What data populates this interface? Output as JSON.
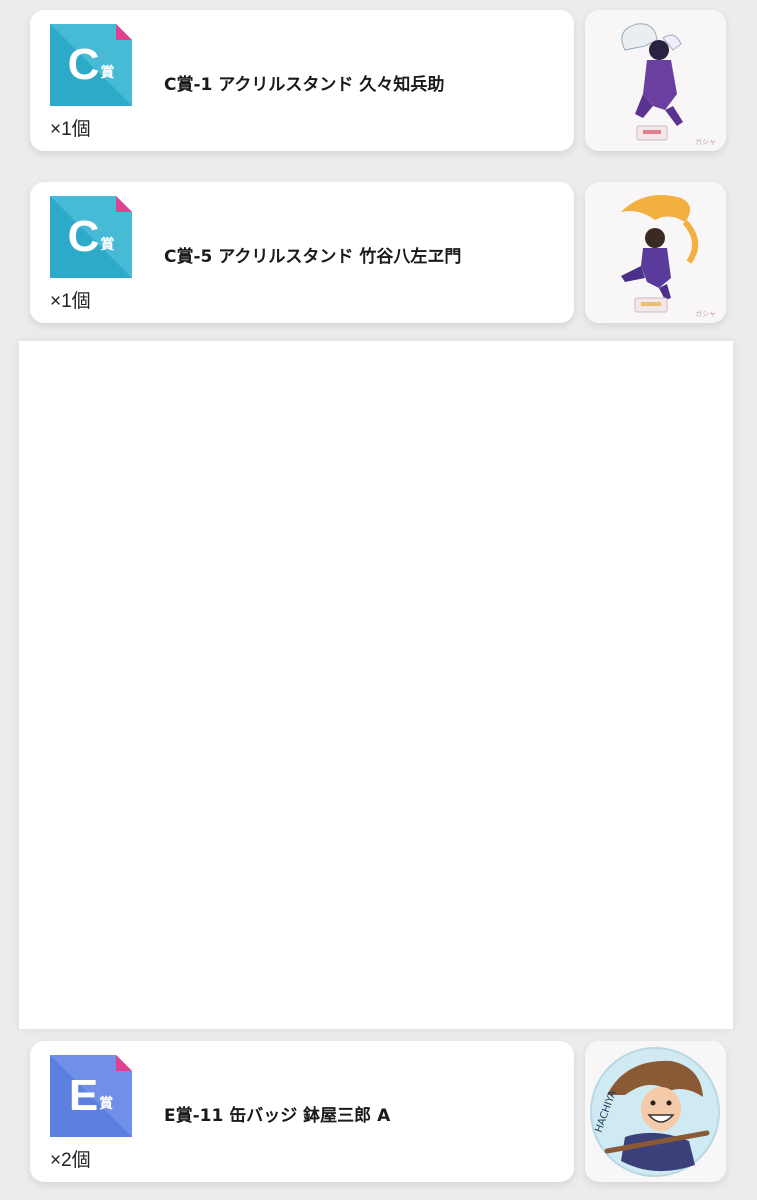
{
  "items": [
    {
      "badge_letter": "C",
      "badge_kanji": "賞",
      "badge_color": "#2eaac9",
      "badge_color_light": "#5cc6df",
      "name": "C賞-1 アクリルスタンド 久々知兵助",
      "quantity": "×1個",
      "thumb_icon": "acrylic-stand-figure-1"
    },
    {
      "badge_letter": "C",
      "badge_kanji": "賞",
      "badge_color": "#2eaac9",
      "badge_color_light": "#5cc6df",
      "name": "C賞-5 アクリルスタンド 竹谷八左ヱ門",
      "quantity": "×1個",
      "thumb_icon": "acrylic-stand-figure-5"
    },
    {
      "badge_letter": "E",
      "badge_kanji": "賞",
      "badge_color": "#5d7fe0",
      "badge_color_light": "#7f9cf0",
      "name": "E賞-11 缶バッジ 鉢屋三郎 A",
      "quantity": "×2個",
      "thumb_icon": "can-badge-round"
    }
  ],
  "accent_corner_color": "#e0418f"
}
